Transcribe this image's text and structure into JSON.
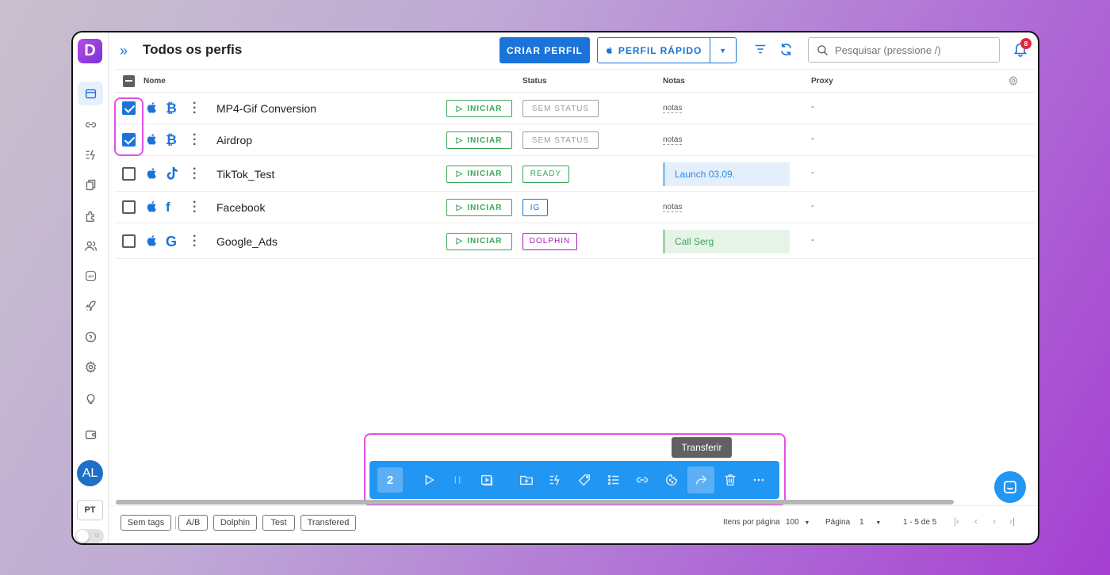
{
  "sidebar": {
    "logo": "D",
    "avatar": "AL",
    "language": "PT",
    "items": [
      "profiles-icon",
      "link-icon",
      "automation-icon",
      "copy-icon",
      "extensions-icon",
      "users-icon",
      "api-icon",
      "rocket-icon",
      "help-icon",
      "settings-icon",
      "lightbulb-icon",
      "wallet-icon"
    ]
  },
  "header": {
    "title": "Todos os perfis",
    "create_label": "CRIAR PERFIL",
    "quick_label": "PERFIL RÁPIDO",
    "search_placeholder": "Pesquisar (pressione /)",
    "notifications": "8"
  },
  "table": {
    "columns": {
      "name": "Nome",
      "status": "Status",
      "notes": "Notas",
      "proxy": "Proxy"
    },
    "start_label": "INICIAR",
    "rows": [
      {
        "name": "MP4-Gif Conversion",
        "checked": true,
        "brand_icon": "bitcoin-icon",
        "status": "SEM STATUS",
        "status_color": "#9e9e9e",
        "note": "notas",
        "note_type": "link",
        "proxy": "-"
      },
      {
        "name": "Airdrop",
        "checked": true,
        "brand_icon": "bitcoin-icon",
        "status": "SEM STATUS",
        "status_color": "#9e9e9e",
        "note": "notas",
        "note_type": "link",
        "proxy": "-"
      },
      {
        "name": "TikTok_Test",
        "checked": false,
        "brand_icon": "tiktok-icon",
        "status": "READY",
        "status_color": "#3aa655",
        "note": "Launch 03.09.",
        "note_type": "box",
        "note_bg": "#e3f0fc",
        "note_border": "#90c2f2",
        "note_color": "#2a8be0",
        "proxy": "-"
      },
      {
        "name": "Facebook",
        "checked": false,
        "brand_icon": "facebook-icon",
        "status": "IG",
        "status_color": "#1a73d9",
        "note": "notas",
        "note_type": "link",
        "proxy": "-"
      },
      {
        "name": "Google_Ads",
        "checked": false,
        "brand_icon": "google-icon",
        "status": "DOLPHIN",
        "status_color": "#a51eb5",
        "note": "Call Serg",
        "note_type": "box",
        "note_bg": "#e6f4e8",
        "note_border": "#9fd4a8",
        "note_color": "#3aa655",
        "proxy": "-"
      }
    ]
  },
  "bulk": {
    "count": "2",
    "tooltip": "Transferir"
  },
  "footer": {
    "tags": [
      "Sem tags",
      "A/B",
      "Dolphin",
      "Test",
      "Transfered"
    ],
    "per_page_label": "Itens por página",
    "per_page_value": "100",
    "page_label": "Página",
    "page_value": "1",
    "range": "1 - 5 de 5"
  }
}
